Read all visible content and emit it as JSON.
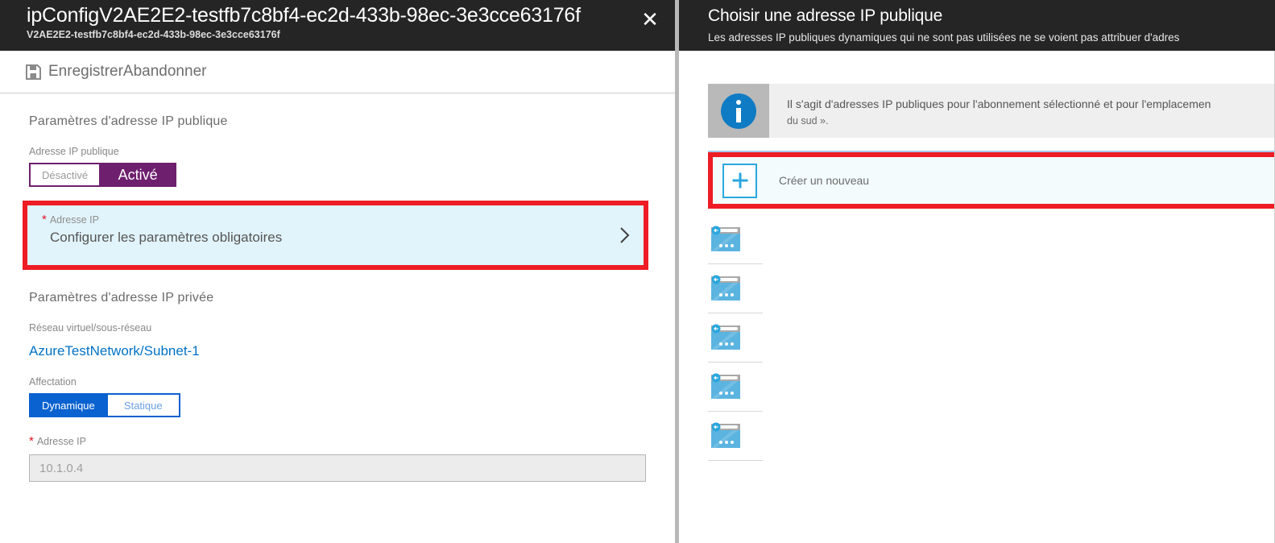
{
  "left_blade": {
    "title": "ipConfigV2AE2E2-testfb7c8bf4-ec2d-433b-98ec-3e3cce63176f",
    "subtitle": "V2AE2E2-testfb7c8bf4-ec2d-433b-98ec-3e3cce63176f",
    "close_label": "✕",
    "toolbar": {
      "save_label": "Enregistrer",
      "discard_label": "Abandonner",
      "save_icon": "save-disk-icon"
    },
    "public_section": {
      "heading": "Paramètres d'adresse IP publique",
      "toggle_label": "Adresse IP publique",
      "toggle_off": "Désactivé",
      "toggle_on": "Activé",
      "selected": "Activé"
    },
    "ip_selector": {
      "label": "Adresse IP",
      "value": "Configurer les paramètres obligatoires",
      "chevron_icon": "chevron-right-icon",
      "required": true
    },
    "private_section": {
      "heading": "Paramètres d'adresse IP privée",
      "vnet_label": "Réseau virtuel/sous-réseau",
      "vnet_value": "AzureTestNetwork/Subnet-1",
      "allocation_label": "Affectation",
      "allocation_dynamic": "Dynamique",
      "allocation_static": "Statique",
      "allocation_selected": "Dynamique",
      "ip_label": "Adresse IP",
      "ip_value": "10.1.0.4"
    }
  },
  "right_blade": {
    "title": "Choisir une adresse IP publique",
    "subtitle": "Les adresses IP publiques dynamiques qui ne sont pas utilisées ne se voient pas attribuer d'adres",
    "info": {
      "icon": "info-circle-icon",
      "line1": "Il s'agit d'adresses IP publiques pour l'abonnement sélectionné et pour l'emplacemen",
      "line2": "du sud »."
    },
    "create_new": {
      "label": "Créer un nouveau",
      "icon": "plus-icon"
    },
    "ip_list": [
      {
        "icon": "public-ip-address-icon",
        "label": ""
      },
      {
        "icon": "public-ip-address-icon",
        "label": ""
      },
      {
        "icon": "public-ip-address-icon",
        "label": ""
      },
      {
        "icon": "public-ip-address-icon",
        "label": ""
      },
      {
        "icon": "public-ip-address-icon",
        "label": ""
      }
    ]
  },
  "colors": {
    "header_bg": "#252525",
    "highlight_red": "#ee1c25",
    "purple_accent": "#6e1f6e",
    "blue_accent": "#0a62d0",
    "link_blue": "#0072c6",
    "selector_bg": "#e1f4fb",
    "info_bg": "#efefef",
    "icon_blue": "#5bb4e0"
  }
}
